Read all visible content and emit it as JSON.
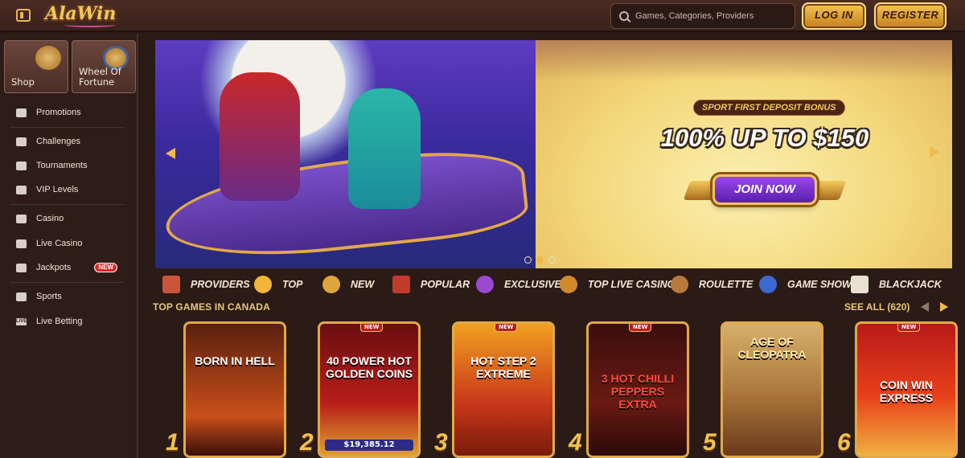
{
  "header": {
    "logo": "AlaWin",
    "search_placeholder": "Games, Categories, Providers",
    "login_label": "LOG IN",
    "register_label": "REGISTER"
  },
  "sidebar": {
    "tiles": [
      {
        "label": "Shop",
        "icon": "shop-bag-icon"
      },
      {
        "label": "Wheel Of Fortune",
        "icon": "wheel-icon"
      }
    ],
    "items": [
      {
        "label": "Promotions",
        "icon": "promotions-icon"
      },
      {
        "label": "Challenges",
        "icon": "challenges-icon"
      },
      {
        "label": "Tournaments",
        "icon": "trophy-icon"
      },
      {
        "label": "VIP Levels",
        "icon": "diamond-icon"
      },
      {
        "label": "Casino",
        "icon": "casino-icon"
      },
      {
        "label": "Live Casino",
        "icon": "cards-icon"
      },
      {
        "label": "Jackpots",
        "icon": "jackpot-icon",
        "badge": "NEW"
      },
      {
        "label": "Sports",
        "icon": "sports-icon"
      },
      {
        "label": "Live Betting",
        "icon": "live-icon",
        "icon_text": "LIVE"
      }
    ]
  },
  "banner": {
    "tag": "SPORT FIRST DEPOSIT BONUS",
    "title": "100% UP TO $150",
    "cta": "JOIN NOW",
    "slides": 3,
    "active_slide": 2
  },
  "categories": [
    {
      "label": "PROVIDERS",
      "icon": "scroll-icon",
      "color": "#c9553a"
    },
    {
      "label": "TOP",
      "icon": "star-icon",
      "color": "#f2b43a"
    },
    {
      "label": "NEW",
      "icon": "lamp-icon",
      "color": "#e0a53a"
    },
    {
      "label": "POPULAR",
      "icon": "carpet-icon",
      "color": "#c23a2a"
    },
    {
      "label": "EXCLUSIVE",
      "icon": "gem-icon",
      "color": "#9a4ad0"
    },
    {
      "label": "TOP LIVE CASINO",
      "icon": "chips-icon",
      "color": "#d08a2a"
    },
    {
      "label": "ROULETTE",
      "icon": "roulette-icon",
      "color": "#b87a3a"
    },
    {
      "label": "GAME SHOWS",
      "icon": "wheel-icon",
      "color": "#3a6ad0"
    },
    {
      "label": "BLACKJACK",
      "icon": "cards-icon",
      "color": "#e8e0d0"
    }
  ],
  "top_games": {
    "title": "TOP GAMES IN CANADA",
    "see_all": "SEE ALL (620)",
    "games": [
      {
        "rank": "1",
        "title": "BORN IN HELL",
        "new": "",
        "jackpot": "",
        "bg": "#7a2a12"
      },
      {
        "rank": "2",
        "title": "40 POWER HOT GOLDEN COINS",
        "new": "NEW",
        "jackpot": "$19,385.12",
        "bg": "#8a1a1a"
      },
      {
        "rank": "3",
        "title": "HOT STEP 2 EXTREME",
        "new": "NEW",
        "jackpot": "",
        "bg": "#c8471a"
      },
      {
        "rank": "4",
        "title": "3 HOT CHILLI PEPPERS EXTRA",
        "new": "NEW",
        "jackpot": "",
        "bg": "#4a1412"
      },
      {
        "rank": "5",
        "title": "AGE OF CLEOPATRA",
        "new": "",
        "jackpot": "",
        "bg": "#a87a3a"
      },
      {
        "rank": "6",
        "title": "COIN WIN EXPRESS",
        "new": "NEW",
        "jackpot": "",
        "bg": "#9a1a1a"
      }
    ]
  }
}
